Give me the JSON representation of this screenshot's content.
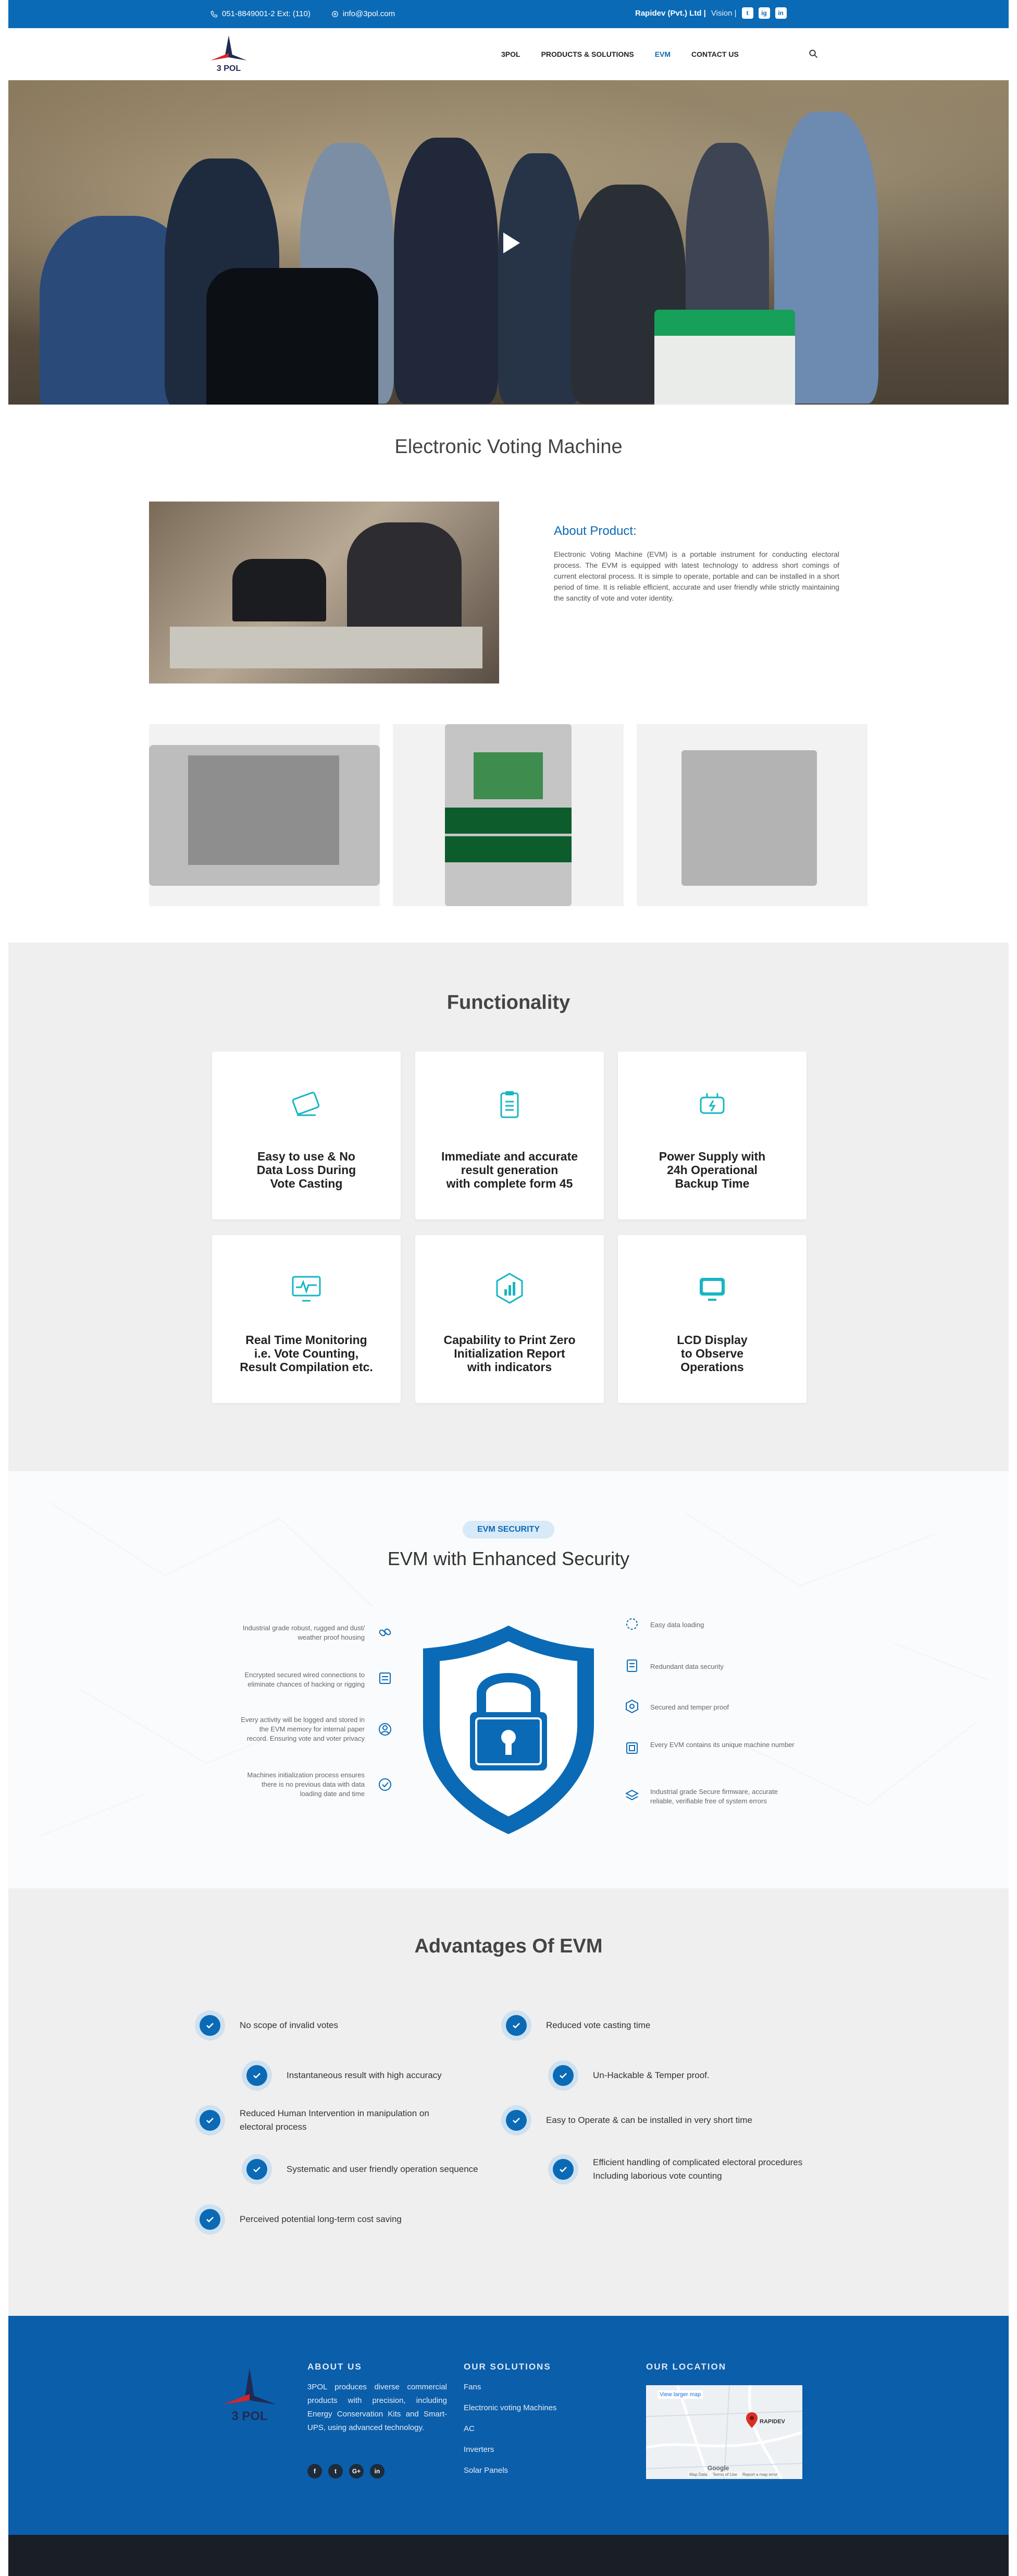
{
  "topbar": {
    "phone": "051-8849001-2 Ext: (110)",
    "email": "info@3pol.com",
    "company": "Rapidev (Pvt.) Ltd |",
    "vision": "Vision |",
    "social": [
      "t",
      "ig",
      "in"
    ]
  },
  "nav": {
    "logo_text": "3 POL",
    "items": [
      "3POL",
      "PRODUCTS & SOLUTIONS",
      "EVM",
      "CONTACT US"
    ],
    "active": "EVM"
  },
  "page_title": "Electronic Voting Machine",
  "about": {
    "title": "About Product:",
    "text": "Electronic Voting Machine (EVM) is a portable instrument for conducting electoral process. The EVM is equipped with latest technology to address short comings of current electoral process. It is simple to operate, portable and can be installed in a short period of time. It is reliable efficient, accurate and user friendly while strictly maintaining the sanctity of vote and voter identity."
  },
  "functionality": {
    "title": "Functionality",
    "cards": [
      {
        "label": "Easy to use & No\nData Loss During\nVote Casting",
        "icon": "tablet-icon"
      },
      {
        "label": "Immediate and accurate\nresult generation\nwith complete form 45",
        "icon": "clipboard-icon"
      },
      {
        "label": "Power Supply with\n24h Operational\nBackup Time",
        "icon": "plug-icon"
      },
      {
        "label": "Real Time Monitoring\ni.e. Vote Counting,\nResult Compilation etc.",
        "icon": "monitor-pulse-icon"
      },
      {
        "label": "Capability to Print Zero\nInitialization Report\nwith indicators",
        "icon": "chart-hexagon-icon"
      },
      {
        "label": "LCD Display\nto Observe\nOperations",
        "icon": "lcd-icon"
      }
    ]
  },
  "security": {
    "badge": "EVM SECURITY",
    "title": "EVM with Enhanced Security",
    "left": [
      "Industrial grade robust, rugged and dust/ weather proof housing",
      "Encrypted secured wired connections to eliminate chances of hacking or rigging",
      "Every activity will be logged and stored in the EVM memory for internal paper record. Ensuring vote and voter privacy",
      "Machines initialization process ensures there is no previous data with data loading date and time"
    ],
    "right": [
      "Easy data loading",
      "Redundant data security",
      "Secured and temper proof",
      "Every EVM contains its unique machine number",
      "Industrial grade Secure firmware, accurate reliable, verifiable free of system errors"
    ]
  },
  "advantages": {
    "title": "Advantages Of EVM",
    "items": [
      "No scope of invalid votes",
      "Reduced vote casting time",
      "Instantaneous result with high accuracy",
      "Un-Hackable & Temper proof.",
      "Reduced Human Intervention in manipulation on electoral process",
      "Easy to Operate & can be installed in very short time",
      "Systematic and user friendly operation sequence",
      "Efficient handling of complicated electoral procedures Including laborious vote counting",
      "Perceived potential long-term cost saving"
    ]
  },
  "footer": {
    "logo_text": "3 POL",
    "about_title": "ABOUT US",
    "about_text": "3POL produces diverse commercial products with precision, including Energy Conservation Kits and Smart-UPS, using advanced technology.",
    "social": [
      "f",
      "t",
      "G+",
      "in"
    ],
    "solutions_title": "OUR SOLUTIONS",
    "solutions": [
      "Fans",
      "Electronic voting Machines",
      "AC",
      "Inverters",
      "Solar Panels"
    ],
    "location_title": "OUR LOCATION",
    "map_link": "View larger map",
    "map_pin": "RAPIDEV",
    "map_brand": "Google",
    "map_footer": [
      "Map Data",
      "Terms of Use",
      "Report a map error"
    ]
  }
}
